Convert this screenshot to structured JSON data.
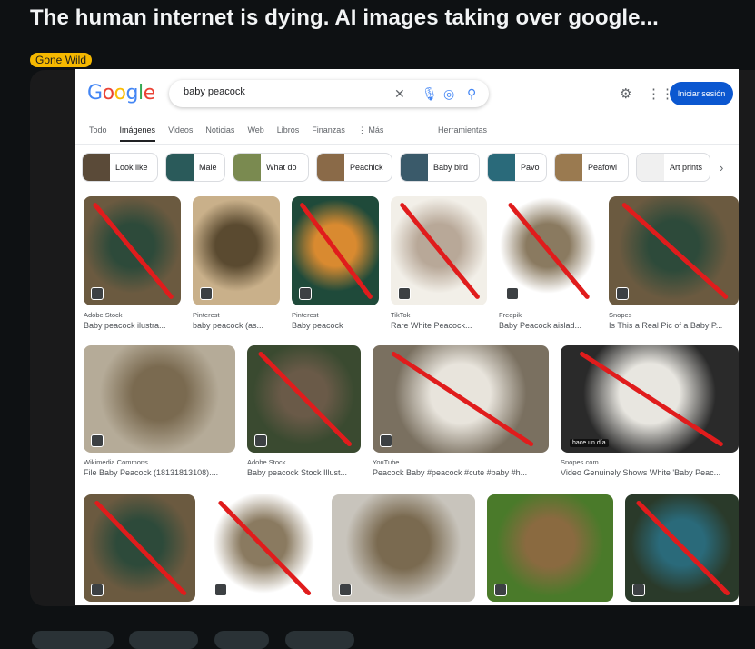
{
  "post": {
    "title": "The human internet is dying. AI images taking over google...",
    "flair": "Gone Wild"
  },
  "google": {
    "logo": [
      "G",
      "o",
      "o",
      "g",
      "l",
      "e"
    ],
    "search_value": "baby peacock",
    "sign_in": "Iniciar sesión",
    "tabs": [
      "Todo",
      "Imágenes",
      "Videos",
      "Noticias",
      "Web",
      "Libros",
      "Finanzas",
      "⋮ Más"
    ],
    "tools": "Herramientas",
    "chips": [
      "Look like",
      "Male",
      "What do",
      "Peachick",
      "Baby bird",
      "Pavo",
      "Peafowl",
      "Art prints"
    ]
  },
  "results": [
    {
      "source": "Adobe Stock",
      "title": "Baby peacock ilustra...",
      "crossed": true,
      "colors": [
        "#6b5a40",
        "#2d4a3a"
      ]
    },
    {
      "source": "Pinterest",
      "title": "baby peacock (as...",
      "crossed": false,
      "colors": [
        "#c9b08a",
        "#5a4a30"
      ]
    },
    {
      "source": "Pinterest",
      "title": "Baby peacock",
      "crossed": true,
      "colors": [
        "#1f4a3a",
        "#d98a30"
      ]
    },
    {
      "source": "TikTok",
      "title": "Rare White Peacock...",
      "crossed": true,
      "colors": [
        "#f2efe8",
        "#b8a898"
      ]
    },
    {
      "source": "Freepik",
      "title": "Baby Peacock aislad...",
      "crossed": true,
      "colors": [
        "#ffffff",
        "#8a7a60"
      ]
    },
    {
      "source": "Snopes",
      "title": "Is This a Real Pic of a Baby P...",
      "crossed": true,
      "colors": [
        "#6b5a40",
        "#2d4a3a"
      ]
    },
    {
      "source": "Wikimedia Commons",
      "title": "File Baby Peacock (18131813108)....",
      "crossed": false,
      "colors": [
        "#b5ab98",
        "#7a6a50"
      ]
    },
    {
      "source": "Adobe Stock",
      "title": "Baby peacock Stock Illust...",
      "crossed": true,
      "colors": [
        "#3a4a30",
        "#6a5a48"
      ]
    },
    {
      "source": "YouTube",
      "title": "Peacock Baby #peacock #cute #baby #h...",
      "crossed": true,
      "colors": [
        "#7a7060",
        "#e8e4dc"
      ]
    },
    {
      "source": "Snopes.com",
      "title": "Video Genuinely Shows White 'Baby Peac...",
      "crossed": true,
      "colors": [
        "#2a2a2a",
        "#e8e6e0"
      ]
    },
    {
      "source": "",
      "title": "",
      "crossed": true,
      "colors": [
        "#6b5a40",
        "#2d4a3a"
      ]
    },
    {
      "source": "",
      "title": "",
      "crossed": true,
      "colors": [
        "#ffffff",
        "#8a7a60"
      ]
    },
    {
      "source": "",
      "title": "",
      "crossed": false,
      "colors": [
        "#c8c4bc",
        "#7a6a50"
      ]
    },
    {
      "source": "",
      "title": "",
      "crossed": false,
      "colors": [
        "#4a7a2a",
        "#8a6a40"
      ]
    },
    {
      "source": "",
      "title": "",
      "crossed": true,
      "colors": [
        "#2a3a2a",
        "#2a6a7a"
      ]
    }
  ],
  "overlay_label": "hace un día",
  "colors": {
    "accent": "#0b57d0",
    "cross_red": "#e01c1c",
    "flair": "#f5b800"
  }
}
